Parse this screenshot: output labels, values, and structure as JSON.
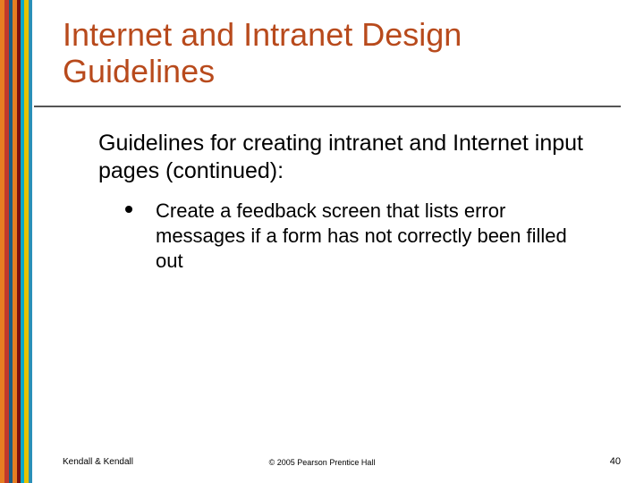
{
  "title": "Internet and Intranet Design Guidelines",
  "lead": "Guidelines for creating intranet and Internet input pages (continued):",
  "bullets": [
    "Create a feedback screen that lists error messages if a form has not correctly been filled out"
  ],
  "footer": {
    "left": "Kendall & Kendall",
    "center": "© 2005 Pearson Prentice Hall",
    "right": "40"
  }
}
